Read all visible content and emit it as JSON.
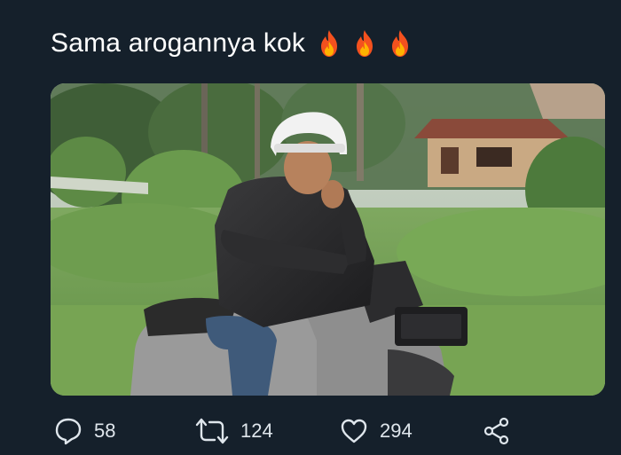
{
  "tweet": {
    "text": "Sama arogannya kok",
    "emoji": [
      "fire",
      "fire",
      "fire"
    ]
  },
  "media": {
    "icon": "photo",
    "description_visible": false
  },
  "actions": {
    "replies": "58",
    "retweets": "124",
    "likes": "294",
    "icons": {
      "reply": "reply-icon",
      "retweet": "retweet-icon",
      "like": "like-icon",
      "share": "share-icon"
    }
  },
  "colors": {
    "background": "#15202b",
    "text": "#ffffff",
    "action_text": "#dfe6ec",
    "fire_outer": "#f4511e",
    "fire_inner": "#ffb300"
  }
}
